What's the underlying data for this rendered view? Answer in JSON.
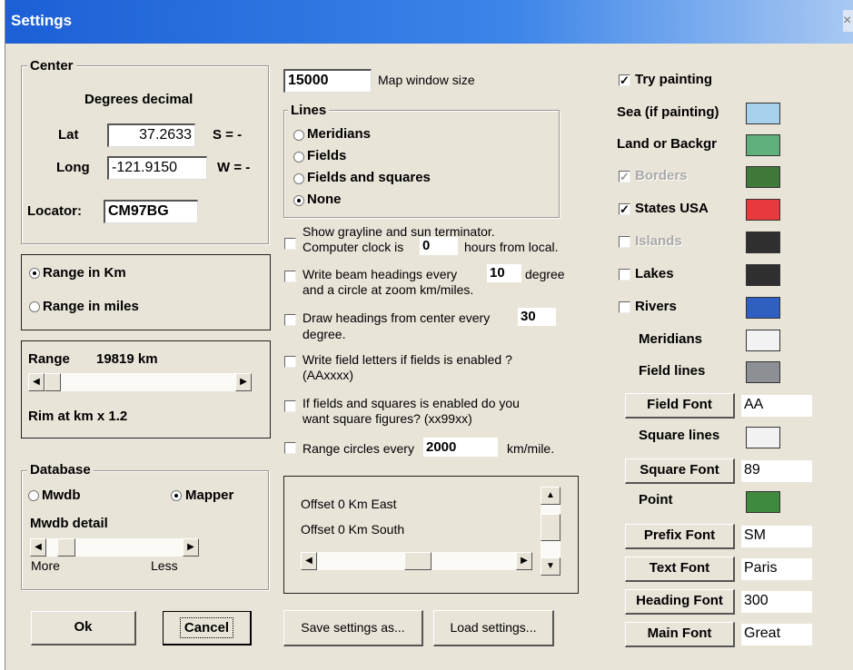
{
  "window": {
    "title": "Settings",
    "close_glyph": "×"
  },
  "center": {
    "group_title": "Center",
    "format_label": "Degrees decimal",
    "lat_label": "Lat",
    "lat_value": "37.2633",
    "lat_hemi": "S = -",
    "long_label": "Long",
    "long_value": "-121.9150",
    "long_hemi": "W = -",
    "locator_label": "Locator:",
    "locator_value": "CM97BG"
  },
  "range_units": {
    "km_label": "Range in Km",
    "miles_label": "Range in miles",
    "selected": "km"
  },
  "range": {
    "label": "Range",
    "value": "19819 km",
    "rim_label": "Rim at km x 1.2",
    "scroll_fraction": 0.0
  },
  "database": {
    "group_title": "Database",
    "mwdb_label": "Mwdb",
    "mapper_label": "Mapper",
    "selected": "mapper",
    "detail_label": "Mwdb detail",
    "more_label": "More",
    "less_label": "Less",
    "scroll_fraction": 0.15
  },
  "buttons": {
    "ok": "Ok",
    "cancel": "Cancel",
    "save": "Save settings as...",
    "load": "Load settings..."
  },
  "map_window": {
    "value": "15000",
    "label": "Map window size"
  },
  "lines": {
    "group_title": "Lines",
    "options": [
      "Meridians",
      "Fields",
      "Fields and squares",
      "None"
    ],
    "selected": "None"
  },
  "options": {
    "grayline_1": "Show grayline and sun terminator.",
    "grayline_2a": "Computer clock is",
    "grayline_value": "0",
    "grayline_2b": "hours from local.",
    "beam_1a": "Write beam headings every",
    "beam_value": "10",
    "beam_1b": "degree",
    "beam_2": "and a circle at zoom km/miles.",
    "headings_1a": "Draw headings from center every",
    "headings_value": "30",
    "headings_2": "degree.",
    "fieldletters_1": "Write field letters if fields is enabled ?",
    "fieldletters_2": "(AAxxxx)",
    "squares_1": "If fields and squares is enabled do you",
    "squares_2": "want square figures? (xx99xx)",
    "circles_a": "Range circles every",
    "circles_value": "2000",
    "circles_b": "km/mile."
  },
  "offset": {
    "east": "Offset 0 Km East",
    "south": "Offset 0 Km South"
  },
  "right": {
    "try_painting": {
      "label": "Try painting",
      "checked": true
    },
    "sea": {
      "label": "Sea (if painting)",
      "color": "#a8d2ec"
    },
    "land": {
      "label": "Land or Backgr",
      "color": "#5fb07a"
    },
    "borders": {
      "label": "Borders",
      "checked": true,
      "disabled": true,
      "color": "#3f7a3a"
    },
    "states": {
      "label": "States USA",
      "checked": true,
      "color": "#e8393d"
    },
    "islands": {
      "label": "Islands",
      "checked": false,
      "disabled": true,
      "color": "#2f2f2f"
    },
    "lakes": {
      "label": "Lakes",
      "checked": false,
      "color": "#2f2f2f"
    },
    "rivers": {
      "label": "Rivers",
      "checked": false,
      "color": "#2f5fc0"
    },
    "meridians": {
      "label": "Meridians",
      "color": "#f2f2f2"
    },
    "field_lines": {
      "label": "Field lines",
      "color": "#8c8f94"
    },
    "field_font": {
      "button": "Field Font",
      "sample": "AA"
    },
    "square_lines": {
      "label": "Square lines",
      "color": "#f2f2f2"
    },
    "square_font": {
      "button": "Square Font",
      "sample": "89"
    },
    "point": {
      "label": "Point",
      "color": "#3f8a3e"
    },
    "prefix_font": {
      "button": "Prefix Font",
      "sample": "SM"
    },
    "text_font": {
      "button": "Text Font",
      "sample": "Paris"
    },
    "heading_font": {
      "button": "Heading Font",
      "sample": "300"
    },
    "main_font": {
      "button": "Main Font",
      "sample": "Great"
    },
    "check_glyph": "✓"
  }
}
